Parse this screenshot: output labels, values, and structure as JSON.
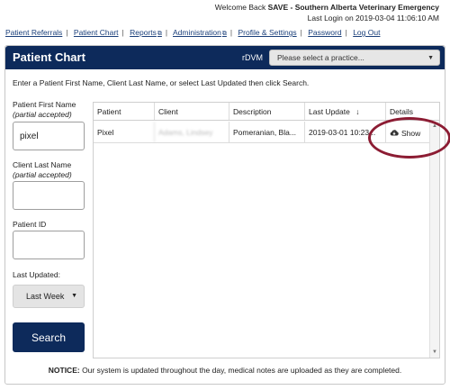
{
  "header": {
    "welcome_prefix": "Welcome Back ",
    "user": "SAVE - Southern Alberta Veterinary Emergency",
    "last_login": "Last Login on 2019-03-04 11:06:10 AM"
  },
  "nav": {
    "items": [
      "Patient Referrals",
      "Patient Chart",
      "Reports",
      "Administration",
      "Profile & Settings",
      "Password",
      "Log Out"
    ],
    "separator": "|",
    "ext_icon": "external-link-icon"
  },
  "panel": {
    "title": "Patient Chart",
    "rdvm_label": "rDVM",
    "practice_placeholder": "Please select a practice...",
    "instructions": "Enter a Patient First Name, Client Last Name, or select Last Updated then click Search."
  },
  "form": {
    "first_name_label": "Patient First Name",
    "first_name_hint": "(partial accepted)",
    "first_name_value": "pixel",
    "last_name_label": "Client Last Name",
    "last_name_hint": "(partial accepted)",
    "last_name_value": "",
    "patient_id_label": "Patient ID",
    "patient_id_value": "",
    "last_updated_label": "Last Updated:",
    "last_updated_value": "Last Week",
    "search_label": "Search"
  },
  "grid": {
    "columns": [
      "Patient",
      "Client",
      "Description",
      "Last Update",
      "Details"
    ],
    "sort_indicator": "↓",
    "rows": [
      {
        "patient": "Pixel",
        "client": "Adams, Lindsey",
        "description": "Pomeranian, Bla...",
        "last_update": "2019-03-01 10:23...",
        "details": "Show"
      }
    ]
  },
  "notice": {
    "label": "NOTICE:",
    "text": " Our system is updated throughout the day, medical notes are uploaded as they are completed."
  },
  "colors": {
    "brand_navy": "#0d2a5b",
    "highlight": "#8c1c33"
  }
}
